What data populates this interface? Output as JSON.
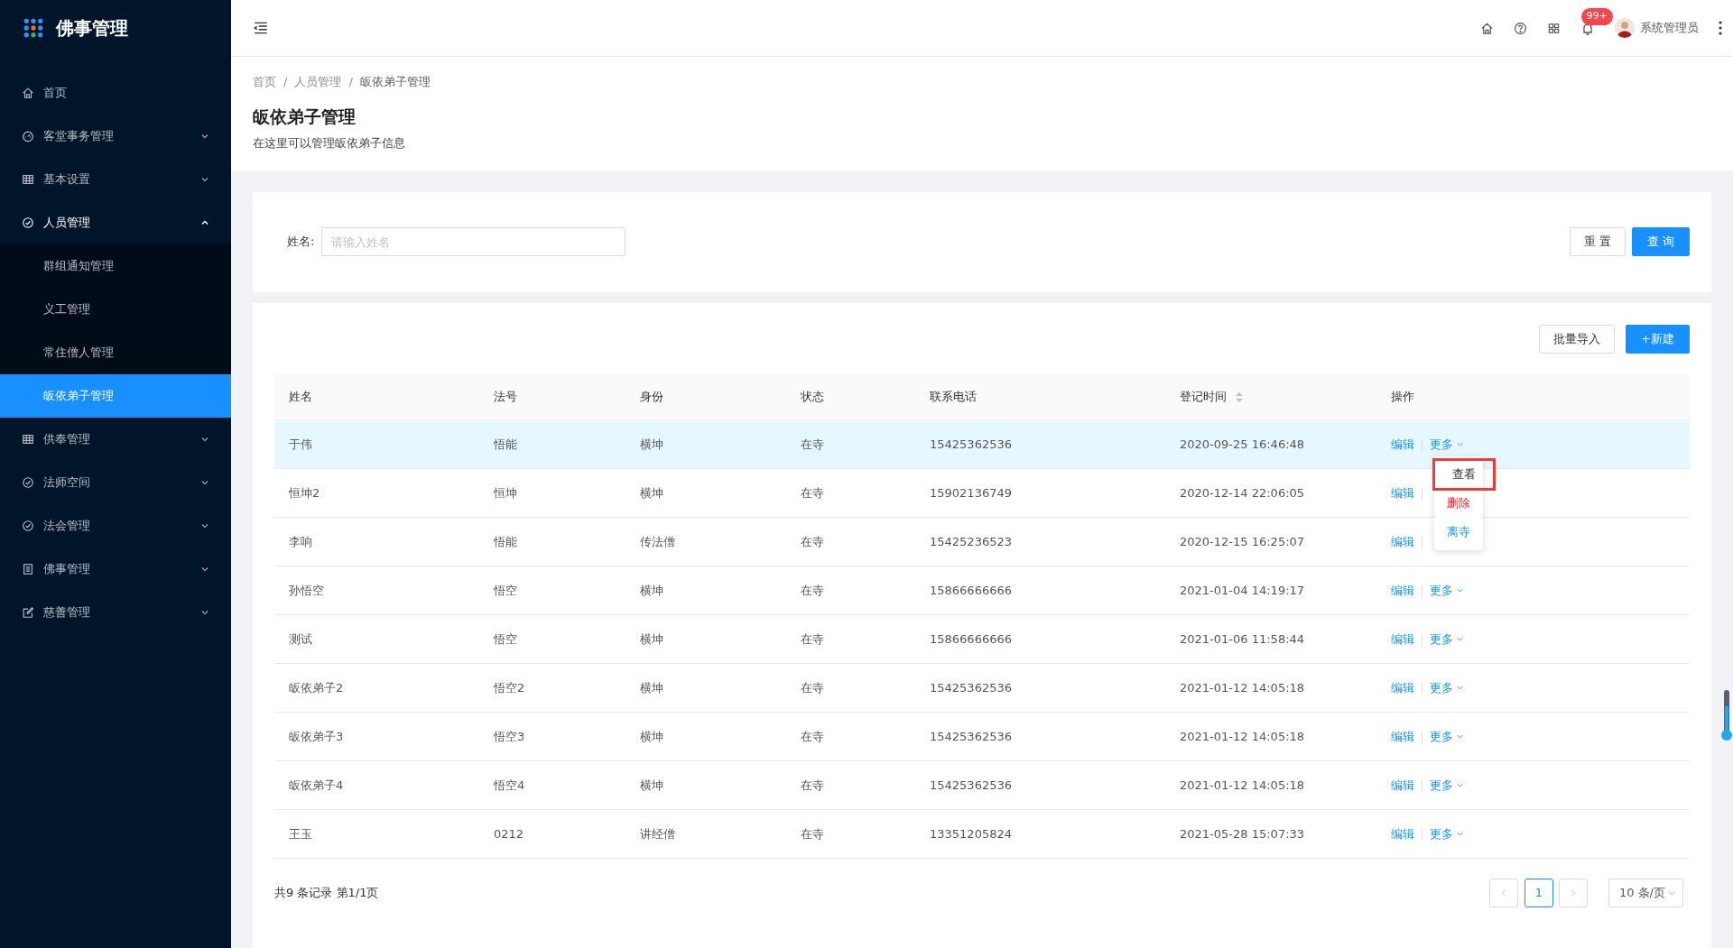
{
  "logo": {
    "title": "佛事管理"
  },
  "sidebar": {
    "items": [
      {
        "label": "首页",
        "expandable": false,
        "expanded": false
      },
      {
        "label": "客堂事务管理",
        "expandable": true,
        "expanded": false
      },
      {
        "label": "基本设置",
        "expandable": true,
        "expanded": false
      },
      {
        "label": "人员管理",
        "expandable": true,
        "expanded": true,
        "children": [
          {
            "label": "群组通知管理",
            "selected": false
          },
          {
            "label": "义工管理",
            "selected": false
          },
          {
            "label": "常住僧人管理",
            "selected": false
          },
          {
            "label": "皈依弟子管理",
            "selected": true
          }
        ]
      },
      {
        "label": "供奉管理",
        "expandable": true,
        "expanded": false
      },
      {
        "label": "法师空间",
        "expandable": true,
        "expanded": false
      },
      {
        "label": "法会管理",
        "expandable": true,
        "expanded": false
      },
      {
        "label": "佛事管理",
        "expandable": true,
        "expanded": false
      },
      {
        "label": "慈善管理",
        "expandable": true,
        "expanded": false
      }
    ]
  },
  "header": {
    "notification_badge": "99+",
    "user": "系统管理员"
  },
  "breadcrumb": {
    "items": [
      "首页",
      "人员管理",
      "皈依弟子管理"
    ],
    "separator": "/"
  },
  "page": {
    "title": "皈依弟子管理",
    "subtitle": "在这里可以管理皈依弟子信息"
  },
  "search": {
    "label": "姓名:",
    "placeholder": "请输入姓名",
    "buttons": [
      "重 置",
      "查 询"
    ]
  },
  "toolbar": {
    "buttons": [
      "批量导入",
      "+新建"
    ]
  },
  "table": {
    "columns": [
      {
        "label": "姓名",
        "sortable": false
      },
      {
        "label": "法号",
        "sortable": false
      },
      {
        "label": "身份",
        "sortable": false
      },
      {
        "label": "状态",
        "sortable": false
      },
      {
        "label": "联系电话",
        "sortable": false
      },
      {
        "label": "登记时间",
        "sortable": true
      },
      {
        "label": "操作",
        "sortable": false
      }
    ],
    "rows": [
      {
        "cells": [
          "于伟",
          "悟能",
          "横坤",
          "在寺",
          "15425362536",
          "2020-09-25 16:46:48"
        ],
        "edit": "编辑",
        "more": "更多",
        "hovered": true
      },
      {
        "cells": [
          "恒坤2",
          "恒坤",
          "横坤",
          "在寺",
          "15902136749",
          "2020-12-14 22:06:05"
        ],
        "edit": "编辑",
        "hovered": false
      },
      {
        "cells": [
          "李响",
          "悟能",
          "传法僧",
          "在寺",
          "15425236523",
          "2020-12-15 16:25:07"
        ],
        "edit": "编辑",
        "hovered": false
      },
      {
        "cells": [
          "孙悟空",
          "悟空",
          "横坤",
          "在寺",
          "15866666666",
          "2021-01-04 14:19:17"
        ],
        "edit": "编辑",
        "more": "更多",
        "hovered": false
      },
      {
        "cells": [
          "测试",
          "悟空",
          "横坤",
          "在寺",
          "15866666666",
          "2021-01-06 11:58:44"
        ],
        "edit": "编辑",
        "more": "更多",
        "hovered": false
      },
      {
        "cells": [
          "皈依弟子2",
          "悟空2",
          "横坤",
          "在寺",
          "15425362536",
          "2021-01-12 14:05:18"
        ],
        "edit": "编辑",
        "more": "更多",
        "hovered": false
      },
      {
        "cells": [
          "皈依弟子3",
          "悟空3",
          "横坤",
          "在寺",
          "15425362536",
          "2021-01-12 14:05:18"
        ],
        "edit": "编辑",
        "more": "更多",
        "hovered": false
      },
      {
        "cells": [
          "皈依弟子4",
          "悟空4",
          "横坤",
          "在寺",
          "15425362536",
          "2021-01-12 14:05:18"
        ],
        "edit": "编辑",
        "more": "更多",
        "hovered": false
      },
      {
        "cells": [
          "王玉",
          "0212",
          "讲经僧",
          "在寺",
          "13351205824",
          "2021-05-28 15:07:33"
        ],
        "edit": "编辑",
        "more": "更多",
        "hovered": false
      }
    ]
  },
  "dropdown": {
    "items": [
      {
        "label": "查看",
        "kind": "normal",
        "highlighted": true
      },
      {
        "label": "删除",
        "kind": "danger",
        "highlighted": false
      },
      {
        "label": "离寺",
        "kind": "link",
        "highlighted": false
      }
    ]
  },
  "pagination": {
    "summary": "共9 条记录 第1/1页",
    "pages": [
      {
        "label": "1",
        "selected": true
      }
    ],
    "page_size": "10 条/页"
  }
}
